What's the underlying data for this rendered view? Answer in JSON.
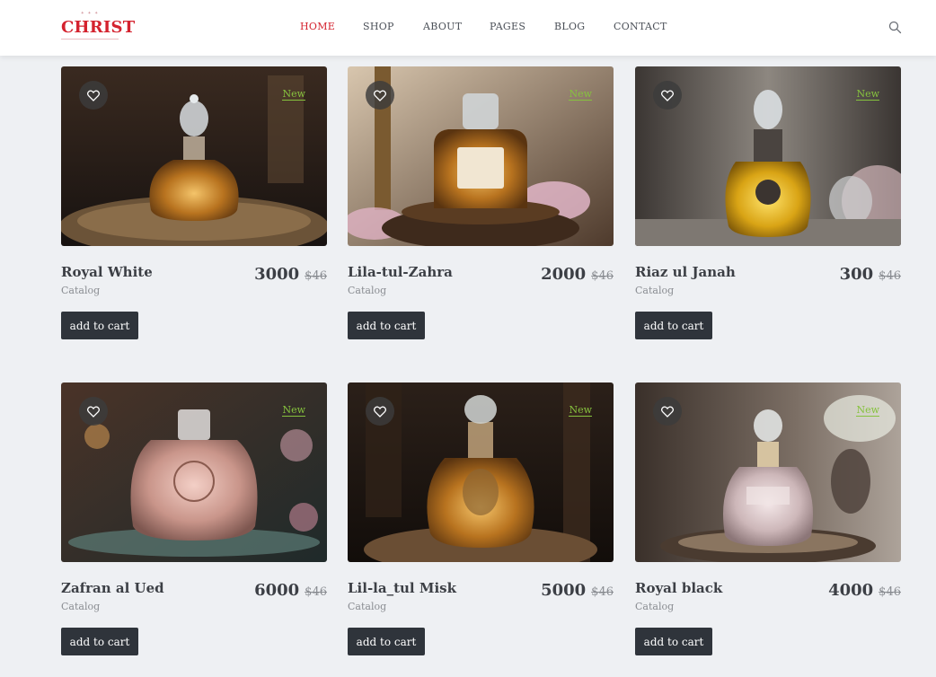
{
  "brand": {
    "name": "CHRIST"
  },
  "nav": {
    "items": [
      {
        "label": "HOME",
        "active": true
      },
      {
        "label": "SHOP",
        "active": false
      },
      {
        "label": "ABOUT",
        "active": false
      },
      {
        "label": "PAGES",
        "active": false
      },
      {
        "label": "BLOG",
        "active": false
      },
      {
        "label": "CONTACT",
        "active": false
      }
    ]
  },
  "header": {
    "search_icon": "search-icon"
  },
  "colors": {
    "accent": "#d4222e",
    "new_badge": "#86c23e",
    "button": "#2f343b",
    "background": "#eef0f3"
  },
  "products": [
    {
      "name": "Royal White",
      "category": "Catalog",
      "price": "3000",
      "old_price": "$46",
      "badge": "New",
      "button": "add to cart"
    },
    {
      "name": "Lila-tul-Zahra",
      "category": "Catalog",
      "price": "2000",
      "old_price": "$46",
      "badge": "New",
      "button": "add to cart"
    },
    {
      "name": "Riaz ul Janah",
      "category": "Catalog",
      "price": "300",
      "old_price": "$46",
      "badge": "New",
      "button": "add to cart"
    },
    {
      "name": "Zafran al Ued",
      "category": "Catalog",
      "price": "6000",
      "old_price": "$46",
      "badge": "New",
      "button": "add to cart"
    },
    {
      "name": "Lil-la_tul Misk",
      "category": "Catalog",
      "price": "5000",
      "old_price": "$46",
      "badge": "New",
      "button": "add to cart"
    },
    {
      "name": "Royal black",
      "category": "Catalog",
      "price": "4000",
      "old_price": "$46",
      "badge": "New",
      "button": "add to cart"
    }
  ]
}
